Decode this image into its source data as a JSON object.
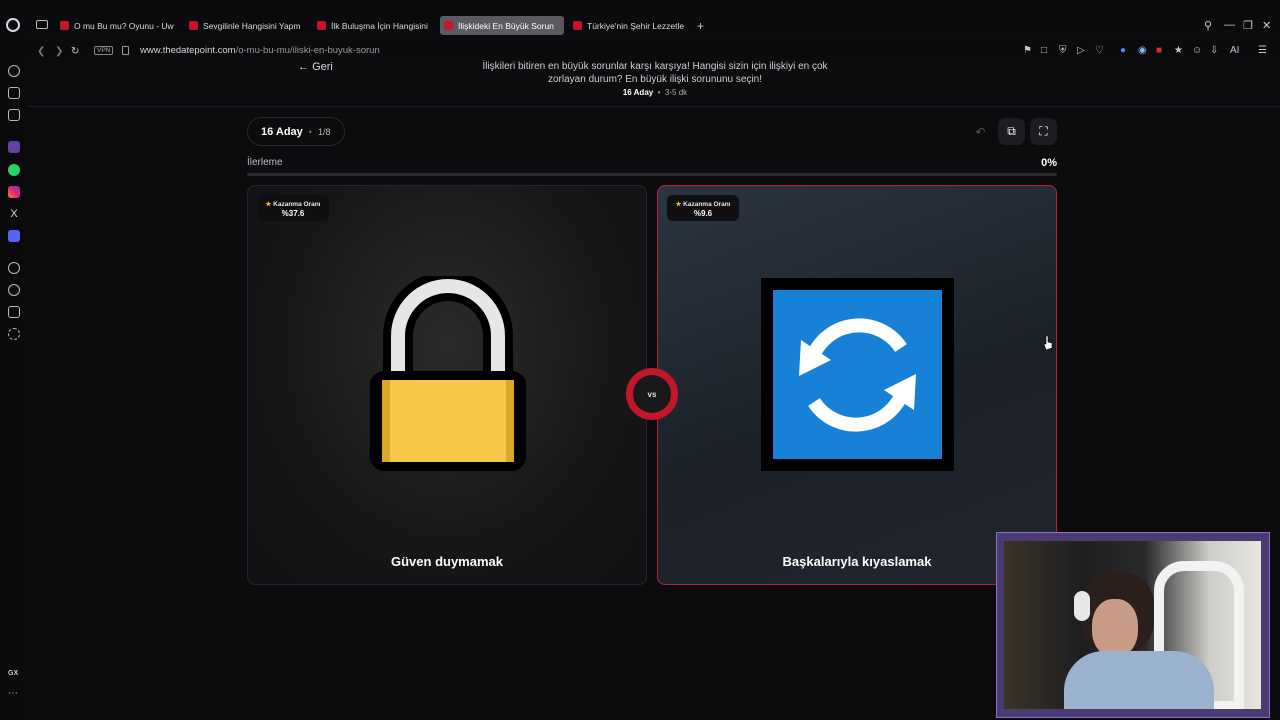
{
  "browser": {
    "tabs": [
      {
        "label": "O mu Bu mu? Oyunu - Uw",
        "active": false
      },
      {
        "label": "Sevgilinle Hangisini Yapm",
        "active": false
      },
      {
        "label": "İlk Buluşma İçin Hangisini",
        "active": false
      },
      {
        "label": "İlişkideki En Büyük Sorun",
        "active": true
      },
      {
        "label": "Türkiye'nin Şehir Lezzetle",
        "active": false
      }
    ],
    "url_host": "www.thedatepoint.com",
    "url_path": "/o-mu-bu-mu/iliski-en-buyuk-sorun",
    "vpn_label": "VPN",
    "ai_label": "AI",
    "sidebar_bottom_label": "GX"
  },
  "header": {
    "back_label": "Geri",
    "description": "İlişkileri bitiren en büyük sorunlar karşı karşıya! Hangisi sizin için ilişkiyi en çok zorlayan durum? En büyük ilişki sorununu seçin!",
    "candidates": "16 Aday",
    "duration": "3-5 dk"
  },
  "game": {
    "candidates_pill": "16 Aday",
    "round": "1/8",
    "progress_label": "İlerleme",
    "progress_text": "0%",
    "progress_value": 0,
    "vs_label": "vs",
    "left": {
      "badge_label": "Kazanma Oranı",
      "badge_value": "%37.6",
      "title": "Güven duymamak",
      "icon": "padlock-open-icon"
    },
    "right": {
      "badge_label": "Kazanma Oranı",
      "badge_value": "%9.6",
      "title": "Başkalarıyla kıyaslamak",
      "icon": "refresh-arrows-icon"
    }
  },
  "colors": {
    "accent_red": "#c01828",
    "lock_yellow": "#f7c948",
    "refresh_blue": "#1781d8"
  }
}
